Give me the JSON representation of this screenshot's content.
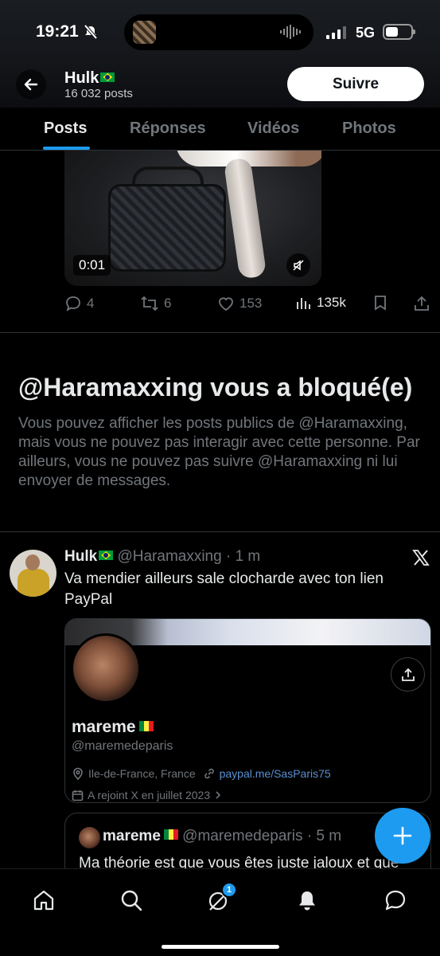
{
  "status_bar": {
    "time": "19:21",
    "network": "5G"
  },
  "header": {
    "name": "Hulk",
    "posts_count": "16 032 posts",
    "follow_label": "Suivre"
  },
  "tabs": [
    {
      "label": "Posts",
      "active": true
    },
    {
      "label": "Réponses",
      "active": false
    },
    {
      "label": "Vidéos",
      "active": false
    },
    {
      "label": "Photos",
      "active": false
    }
  ],
  "video_post": {
    "duration": "0:01",
    "actions": {
      "replies": "4",
      "reposts": "6",
      "likes": "153",
      "views": "135k"
    }
  },
  "blocked_notice": {
    "title": "@Haramaxxing vous a bloqué(e)",
    "body": "Vous pouvez afficher les posts publics de @Haramaxxing, mais vous ne pouvez pas interagir avec cette personne. Par ailleurs, vous ne pouvez pas suivre @Haramaxxing ni lui envoyer de messages."
  },
  "tweet": {
    "author_name": "Hulk",
    "handle_time": "@Haramaxxing · 1 m",
    "text": "Va mendier ailleurs sale clocharde avec ton lien PayPal",
    "profile_card": {
      "name": "mareme",
      "handle": "@maremedeparis",
      "location": "Ile-de-France, France",
      "link": "paypal.me/SasParis75",
      "joined": "A rejoint X en juillet 2023"
    },
    "quote": {
      "name": "mareme",
      "handle_time": "@maremedeparis · 5 m",
      "text": "Ma théorie est que vous êtes juste jaloux et que"
    }
  },
  "bottom_nav": {
    "grok_badge": "1"
  },
  "colors": {
    "accent": "#1d9bf0",
    "background": "#000000",
    "muted": "#71767b",
    "text": "#e7e9ea"
  }
}
